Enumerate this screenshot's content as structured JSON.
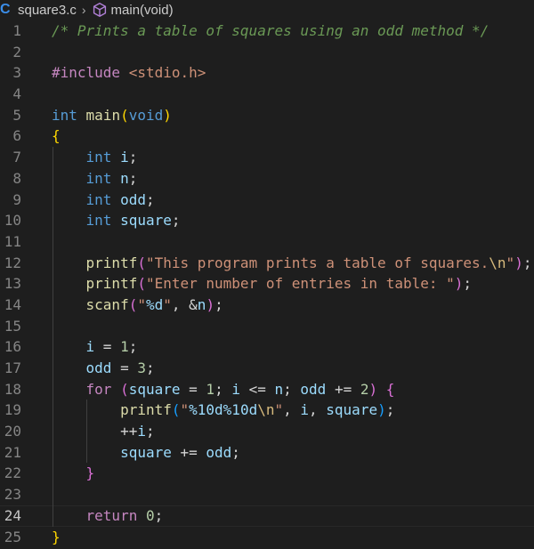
{
  "breadcrumb": {
    "language_glyph": "C",
    "file": "square3.c",
    "separator": "›",
    "symbol_icon": "cube-icon",
    "symbol": "main(void)"
  },
  "editor": {
    "active_line": 24,
    "lines": [
      {
        "number": "1",
        "tokens": [
          {
            "t": "/* Prints a table of squares using an odd method */",
            "c": "comment"
          }
        ]
      },
      {
        "number": "2",
        "tokens": []
      },
      {
        "number": "3",
        "tokens": [
          {
            "t": "#include ",
            "c": "ctrl"
          },
          {
            "t": "<stdio.h>",
            "c": "str"
          }
        ]
      },
      {
        "number": "4",
        "tokens": []
      },
      {
        "number": "5",
        "tokens": [
          {
            "t": "int",
            "c": "kw"
          },
          {
            "t": " ",
            "c": "txt"
          },
          {
            "t": "main",
            "c": "fn"
          },
          {
            "t": "(",
            "c": "br1"
          },
          {
            "t": "void",
            "c": "kw"
          },
          {
            "t": ")",
            "c": "br1"
          }
        ]
      },
      {
        "number": "6",
        "tokens": [
          {
            "t": "{",
            "c": "br1"
          }
        ]
      },
      {
        "number": "7",
        "tokens": [
          {
            "t": "    ",
            "c": "txt"
          },
          {
            "t": "int",
            "c": "kw"
          },
          {
            "t": " ",
            "c": "txt"
          },
          {
            "t": "i",
            "c": "var"
          },
          {
            "t": ";",
            "c": "txt"
          }
        ]
      },
      {
        "number": "8",
        "tokens": [
          {
            "t": "    ",
            "c": "txt"
          },
          {
            "t": "int",
            "c": "kw"
          },
          {
            "t": " ",
            "c": "txt"
          },
          {
            "t": "n",
            "c": "var"
          },
          {
            "t": ";",
            "c": "txt"
          }
        ]
      },
      {
        "number": "9",
        "tokens": [
          {
            "t": "    ",
            "c": "txt"
          },
          {
            "t": "int",
            "c": "kw"
          },
          {
            "t": " ",
            "c": "txt"
          },
          {
            "t": "odd",
            "c": "var"
          },
          {
            "t": ";",
            "c": "txt"
          }
        ]
      },
      {
        "number": "10",
        "tokens": [
          {
            "t": "    ",
            "c": "txt"
          },
          {
            "t": "int",
            "c": "kw"
          },
          {
            "t": " ",
            "c": "txt"
          },
          {
            "t": "square",
            "c": "var"
          },
          {
            "t": ";",
            "c": "txt"
          }
        ]
      },
      {
        "number": "11",
        "tokens": []
      },
      {
        "number": "12",
        "tokens": [
          {
            "t": "    ",
            "c": "txt"
          },
          {
            "t": "printf",
            "c": "fn"
          },
          {
            "t": "(",
            "c": "br2"
          },
          {
            "t": "\"This program prints a table of squares.",
            "c": "str"
          },
          {
            "t": "\\n",
            "c": "esc"
          },
          {
            "t": "\"",
            "c": "str"
          },
          {
            "t": ")",
            "c": "br2"
          },
          {
            "t": ";",
            "c": "txt"
          }
        ]
      },
      {
        "number": "13",
        "tokens": [
          {
            "t": "    ",
            "c": "txt"
          },
          {
            "t": "printf",
            "c": "fn"
          },
          {
            "t": "(",
            "c": "br2"
          },
          {
            "t": "\"Enter number of entries in table: \"",
            "c": "str"
          },
          {
            "t": ")",
            "c": "br2"
          },
          {
            "t": ";",
            "c": "txt"
          }
        ]
      },
      {
        "number": "14",
        "tokens": [
          {
            "t": "    ",
            "c": "txt"
          },
          {
            "t": "scanf",
            "c": "fn"
          },
          {
            "t": "(",
            "c": "br2"
          },
          {
            "t": "\"",
            "c": "str"
          },
          {
            "t": "%d",
            "c": "var"
          },
          {
            "t": "\"",
            "c": "str"
          },
          {
            "t": ", ",
            "c": "txt"
          },
          {
            "t": "&",
            "c": "txt"
          },
          {
            "t": "n",
            "c": "var"
          },
          {
            "t": ")",
            "c": "br2"
          },
          {
            "t": ";",
            "c": "txt"
          }
        ]
      },
      {
        "number": "15",
        "tokens": []
      },
      {
        "number": "16",
        "tokens": [
          {
            "t": "    ",
            "c": "txt"
          },
          {
            "t": "i",
            "c": "var"
          },
          {
            "t": " = ",
            "c": "txt"
          },
          {
            "t": "1",
            "c": "num"
          },
          {
            "t": ";",
            "c": "txt"
          }
        ]
      },
      {
        "number": "17",
        "tokens": [
          {
            "t": "    ",
            "c": "txt"
          },
          {
            "t": "odd",
            "c": "var"
          },
          {
            "t": " = ",
            "c": "txt"
          },
          {
            "t": "3",
            "c": "num"
          },
          {
            "t": ";",
            "c": "txt"
          }
        ]
      },
      {
        "number": "18",
        "tokens": [
          {
            "t": "    ",
            "c": "txt"
          },
          {
            "t": "for",
            "c": "ctrl"
          },
          {
            "t": " ",
            "c": "txt"
          },
          {
            "t": "(",
            "c": "br2"
          },
          {
            "t": "square",
            "c": "var"
          },
          {
            "t": " = ",
            "c": "txt"
          },
          {
            "t": "1",
            "c": "num"
          },
          {
            "t": "; ",
            "c": "txt"
          },
          {
            "t": "i",
            "c": "var"
          },
          {
            "t": " <= ",
            "c": "txt"
          },
          {
            "t": "n",
            "c": "var"
          },
          {
            "t": "; ",
            "c": "txt"
          },
          {
            "t": "odd",
            "c": "var"
          },
          {
            "t": " += ",
            "c": "txt"
          },
          {
            "t": "2",
            "c": "num"
          },
          {
            "t": ")",
            "c": "br2"
          },
          {
            "t": " ",
            "c": "txt"
          },
          {
            "t": "{",
            "c": "br2"
          }
        ]
      },
      {
        "number": "19",
        "tokens": [
          {
            "t": "        ",
            "c": "txt"
          },
          {
            "t": "printf",
            "c": "fn"
          },
          {
            "t": "(",
            "c": "br3"
          },
          {
            "t": "\"",
            "c": "str"
          },
          {
            "t": "%10d%10d",
            "c": "var"
          },
          {
            "t": "\\n",
            "c": "esc"
          },
          {
            "t": "\"",
            "c": "str"
          },
          {
            "t": ", ",
            "c": "txt"
          },
          {
            "t": "i",
            "c": "var"
          },
          {
            "t": ", ",
            "c": "txt"
          },
          {
            "t": "square",
            "c": "var"
          },
          {
            "t": ")",
            "c": "br3"
          },
          {
            "t": ";",
            "c": "txt"
          }
        ]
      },
      {
        "number": "20",
        "tokens": [
          {
            "t": "        ",
            "c": "txt"
          },
          {
            "t": "++",
            "c": "txt"
          },
          {
            "t": "i",
            "c": "var"
          },
          {
            "t": ";",
            "c": "txt"
          }
        ]
      },
      {
        "number": "21",
        "tokens": [
          {
            "t": "        ",
            "c": "txt"
          },
          {
            "t": "square",
            "c": "var"
          },
          {
            "t": " += ",
            "c": "txt"
          },
          {
            "t": "odd",
            "c": "var"
          },
          {
            "t": ";",
            "c": "txt"
          }
        ]
      },
      {
        "number": "22",
        "tokens": [
          {
            "t": "    ",
            "c": "txt"
          },
          {
            "t": "}",
            "c": "br2"
          }
        ]
      },
      {
        "number": "23",
        "tokens": []
      },
      {
        "number": "24",
        "tokens": [
          {
            "t": "    ",
            "c": "txt"
          },
          {
            "t": "return",
            "c": "ctrl"
          },
          {
            "t": " ",
            "c": "txt"
          },
          {
            "t": "0",
            "c": "num"
          },
          {
            "t": ";",
            "c": "txt"
          }
        ]
      },
      {
        "number": "25",
        "tokens": [
          {
            "t": "}",
            "c": "br1"
          }
        ]
      }
    ]
  }
}
